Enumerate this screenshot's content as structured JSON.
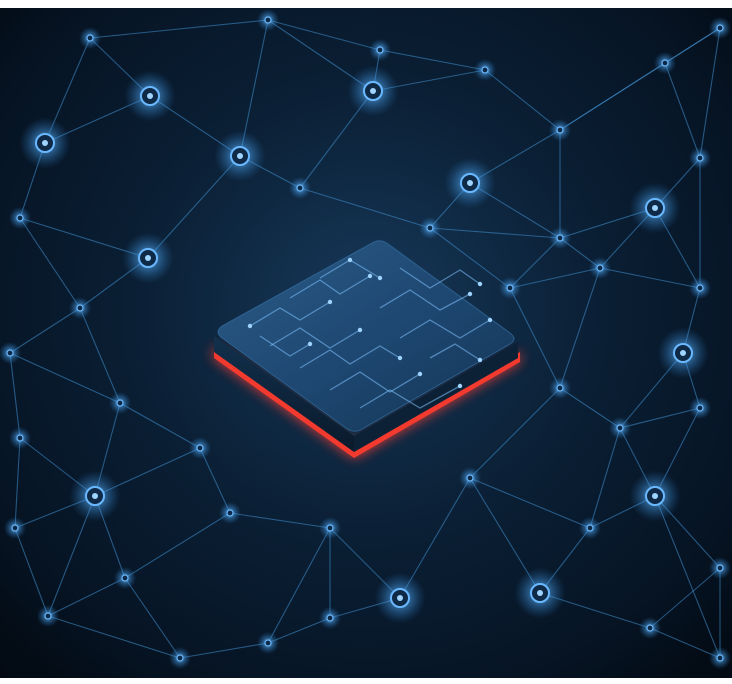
{
  "image": {
    "subject": "microchip-on-network",
    "colors": {
      "background_dark": "#061424",
      "background_mid": "#0e2a46",
      "network_line": "#3f8fd0",
      "node_glow": "#5fb4ff",
      "chip_top": "#1f4a72",
      "chip_side": "#0d2236",
      "chip_glow": "#ff3b2e",
      "circuit_trace": "#7fc2ff"
    }
  }
}
